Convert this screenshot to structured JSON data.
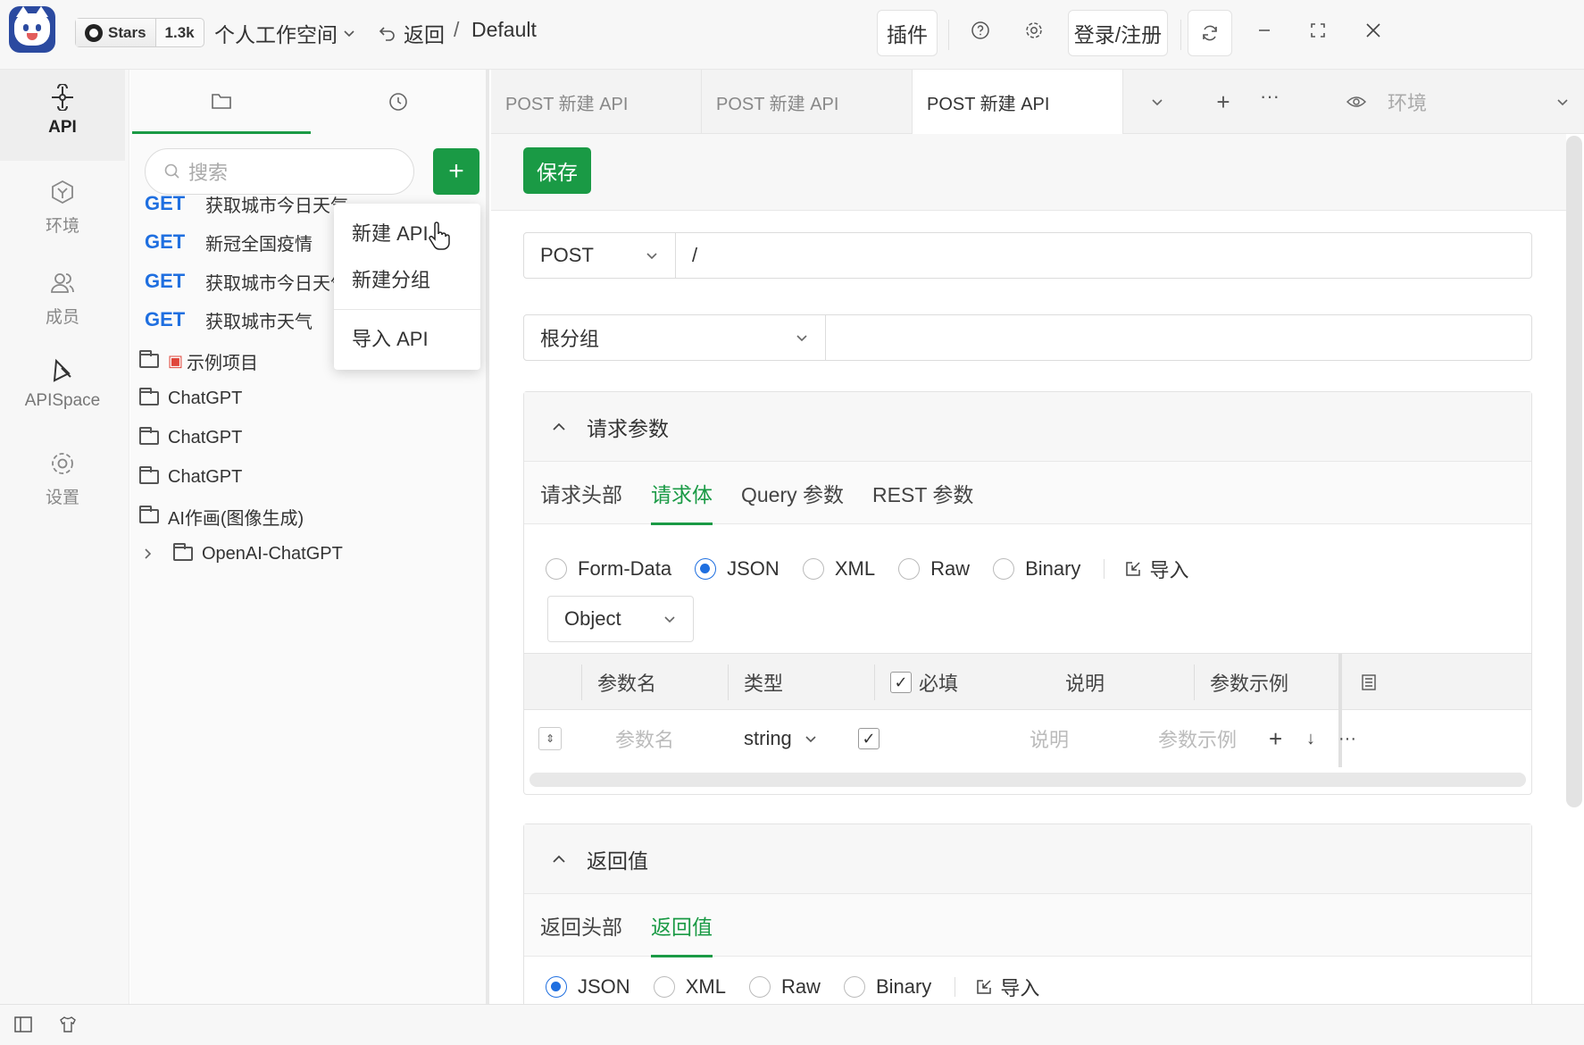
{
  "titlebar": {
    "github_label": "Stars",
    "github_count": "1.3k",
    "workspace": "个人工作空间",
    "back_label": "返回",
    "separator": "/",
    "project": "Default",
    "plugin_label": "插件",
    "login_label": "登录/注册"
  },
  "leftnav": {
    "items": [
      {
        "label": "API",
        "icon": "api-icon"
      },
      {
        "label": "环境",
        "icon": "environment-icon"
      },
      {
        "label": "成员",
        "icon": "members-icon"
      },
      {
        "label": "APISpace",
        "icon": "apispace-icon"
      },
      {
        "label": "设置",
        "icon": "gear-icon"
      }
    ]
  },
  "sidebar": {
    "search_placeholder": "搜索",
    "apis": [
      {
        "method": "GET",
        "name": "获取城市今日天气"
      },
      {
        "method": "GET",
        "name": "新冠全国疫情"
      },
      {
        "method": "GET",
        "name": "获取城市今日天气"
      },
      {
        "method": "GET",
        "name": "获取城市天气"
      }
    ],
    "folders": [
      {
        "name": "示例项目",
        "gift": true
      },
      {
        "name": "ChatGPT"
      },
      {
        "name": "ChatGPT"
      },
      {
        "name": "ChatGPT"
      },
      {
        "name": "AI作画(图像生成)"
      },
      {
        "name": "OpenAI-ChatGPT",
        "collapsed": true
      }
    ]
  },
  "context_menu": {
    "items": [
      "新建 API",
      "新建分组",
      "导入 API"
    ]
  },
  "tabs": [
    {
      "label": "POST  新建 API"
    },
    {
      "label": "POST  新建 API"
    },
    {
      "label": "POST  新建 API",
      "active": true
    }
  ],
  "env_placeholder": "环境",
  "editor": {
    "save_label": "保存",
    "method": "POST",
    "url": "/",
    "group": "根分组",
    "request_section": "请求参数",
    "request_tabs": [
      "请求头部",
      "请求体",
      "Query 参数",
      "REST 参数"
    ],
    "request_active_tab": 1,
    "body_types": [
      "Form-Data",
      "JSON",
      "XML",
      "Raw",
      "Binary"
    ],
    "body_type_selected": "JSON",
    "import_label": "导入",
    "root_type": "Object",
    "table_headers": [
      "参数名",
      "类型",
      "必填",
      "说明",
      "参数示例"
    ],
    "row": {
      "name_placeholder": "参数名",
      "type": "string",
      "required": true,
      "desc_placeholder": "说明",
      "example_placeholder": "参数示例"
    },
    "response_section": "返回值",
    "response_tabs": [
      "返回头部",
      "返回值"
    ],
    "response_active_tab": 1,
    "response_types": [
      "JSON",
      "XML",
      "Raw",
      "Binary"
    ],
    "response_type_selected": "JSON"
  },
  "colors": {
    "accent": "#1a9a45",
    "method_get": "#1f6fe0",
    "radio_on": "#1f6fe0"
  }
}
